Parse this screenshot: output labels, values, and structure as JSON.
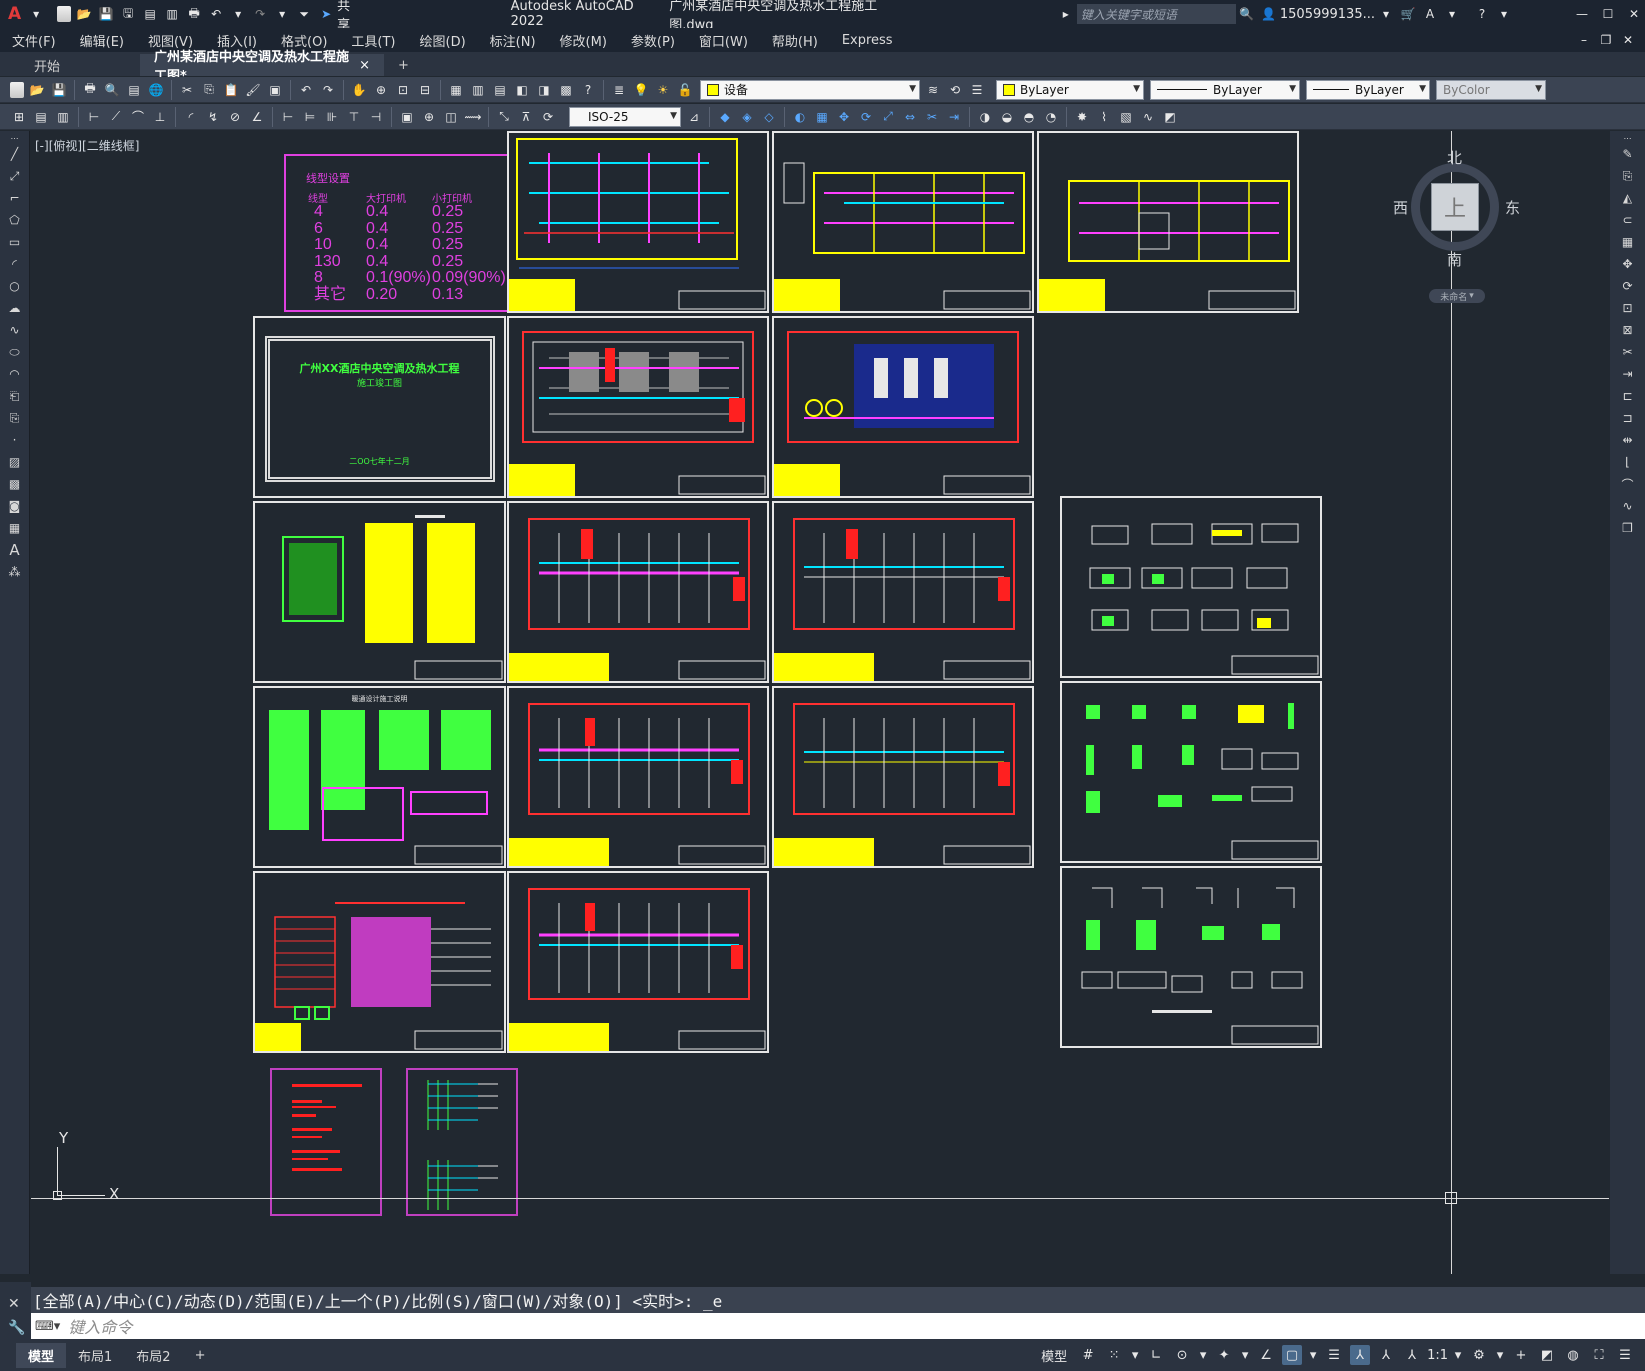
{
  "app": {
    "title": "Autodesk AutoCAD 2022",
    "filename": "广州某酒店中央空调及热水工程施工图.dwg",
    "search_placeholder": "键入关键字或短语",
    "user": "1505999135...",
    "share": "共享"
  },
  "menu": [
    "文件(F)",
    "编辑(E)",
    "视图(V)",
    "插入(I)",
    "格式(O)",
    "工具(T)",
    "绘图(D)",
    "标注(N)",
    "修改(M)",
    "参数(P)",
    "窗口(W)",
    "帮助(H)",
    "Express"
  ],
  "tabs": {
    "start": "开始",
    "active": "广州某酒店中央空调及热水工程施工图*",
    "close": "×",
    "add": "+"
  },
  "toolbar": {
    "layer": "设备",
    "color": "ByLayer",
    "linetype": "ByLayer",
    "lineweight": "ByLayer",
    "plotstyle": "ByColor",
    "dimstyle": "ISO-25"
  },
  "viewport": {
    "label": "[-][俯视][二维线框]",
    "viewcube": {
      "north": "北",
      "south": "南",
      "east": "东",
      "west": "西",
      "top": "上",
      "wcs": "未命名"
    },
    "ucs_x": "X",
    "ucs_y": "Y"
  },
  "drawing": {
    "line_table": {
      "title": "线型设置",
      "headers": [
        "线型",
        "大打印机",
        "小打印机"
      ],
      "rows": [
        [
          "4",
          "0.4",
          "0.25"
        ],
        [
          "6",
          "0.4",
          "0.25"
        ],
        [
          "10",
          "0.4",
          "0.25"
        ],
        [
          "130",
          "0.4",
          "0.25"
        ],
        [
          "8",
          "0.1(90%)",
          "0.09(90%)"
        ],
        [
          "其它",
          "0.20",
          "0.13"
        ]
      ]
    },
    "cover": {
      "title": "广州XX酒店中央空调及热水工程",
      "subtitle": "施工竣工图",
      "date": "二OO七年十二月"
    },
    "notes_title": "暖通设计施工说明"
  },
  "command": {
    "history": "[全部(A)/中心(C)/动态(D)/范围(E)/上一个(P)/比例(S)/窗口(W)/对象(O)] <实时>: _e",
    "placeholder": "键入命令"
  },
  "status": {
    "layouts": [
      "模型",
      "布局1",
      "布局2"
    ],
    "model": "模型",
    "scale": "1:1"
  }
}
